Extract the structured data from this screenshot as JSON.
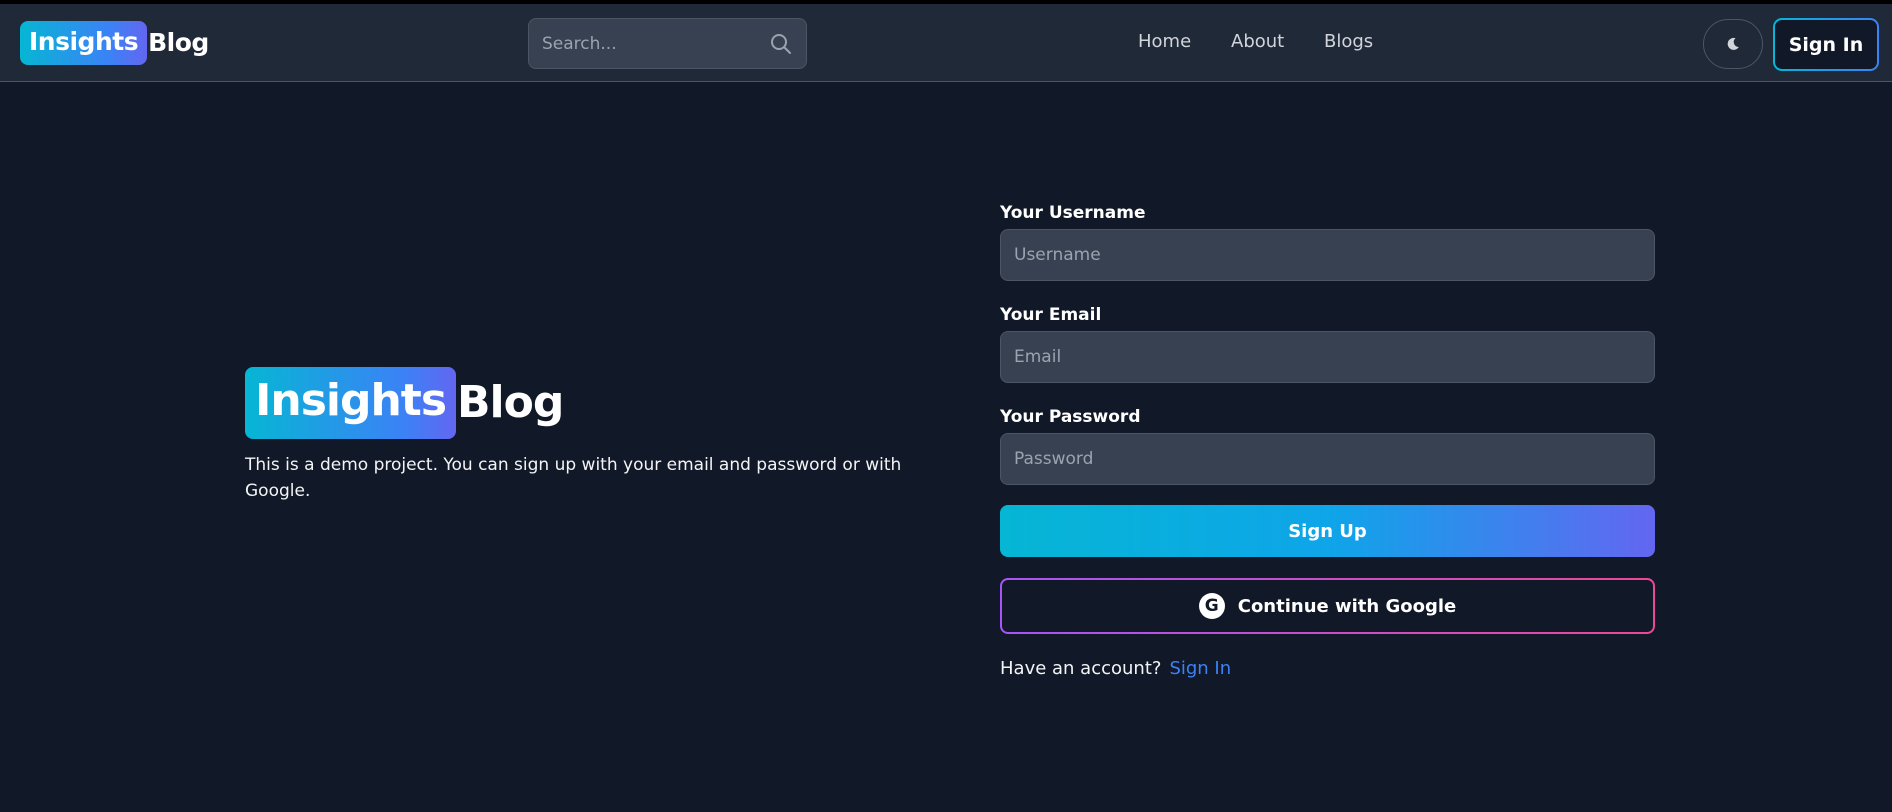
{
  "navbar": {
    "logo_highlight": "Insights",
    "logo_rest": "Blog",
    "search_placeholder": "Search...",
    "links": [
      "Home",
      "About",
      "Blogs"
    ],
    "signin_label": "Sign In"
  },
  "hero": {
    "logo_highlight": "Insights",
    "logo_rest": "Blog",
    "description": "This is a demo project. You can sign up with your email and password or with Google."
  },
  "form": {
    "username_label": "Your Username",
    "username_placeholder": "Username",
    "email_label": "Your Email",
    "email_placeholder": "Email",
    "password_label": "Your Password",
    "password_placeholder": "Password",
    "signup_label": "Sign Up",
    "google_label": "Continue with Google",
    "google_glyph": "G",
    "have_account_text": "Have an account?",
    "signin_link": "Sign In"
  },
  "icons": {
    "search": "search-icon",
    "theme": "moon-icon",
    "google": "google-icon"
  },
  "colors": {
    "background": "#111827",
    "navbar": "#1f2937",
    "input": "#374151",
    "accent_cyan": "#06b6d4",
    "accent_indigo": "#6366f1",
    "accent_pink": "#ec4899",
    "link": "#3b82f6"
  }
}
